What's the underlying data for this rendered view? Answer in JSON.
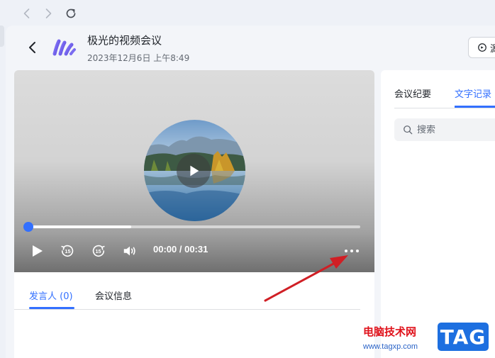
{
  "header": {
    "title": "极光的视频会议",
    "datetime": "2023年12月6日 上午8:49",
    "top_right_button": "源"
  },
  "player": {
    "current_time": "00:00",
    "duration": "00:31",
    "time_display": "00:00 / 00:31",
    "progress_fraction": 0.0,
    "buffered_fraction": 0.31,
    "skip_seconds": "15",
    "accent_color": "#3370ff"
  },
  "left_tabs": {
    "speakers": "发言人 (0)",
    "meeting_info": "会议信息"
  },
  "right_tabs": {
    "summary": "会议纪要",
    "transcript": "文字记录"
  },
  "search": {
    "placeholder": "搜索"
  },
  "watermark": {
    "site_name": "电脑技术网",
    "url": "www.tagxp.com",
    "tag": "TAG"
  },
  "icons": {
    "back": "chevron-left-icon",
    "forward": "chevron-right-icon",
    "reload": "reload-icon",
    "logo": "app-logo",
    "play": "play-icon",
    "rewind": "rewind-15-icon",
    "forward15": "forward-15-icon",
    "volume": "volume-icon",
    "more": "more-icon",
    "search": "search-icon"
  }
}
